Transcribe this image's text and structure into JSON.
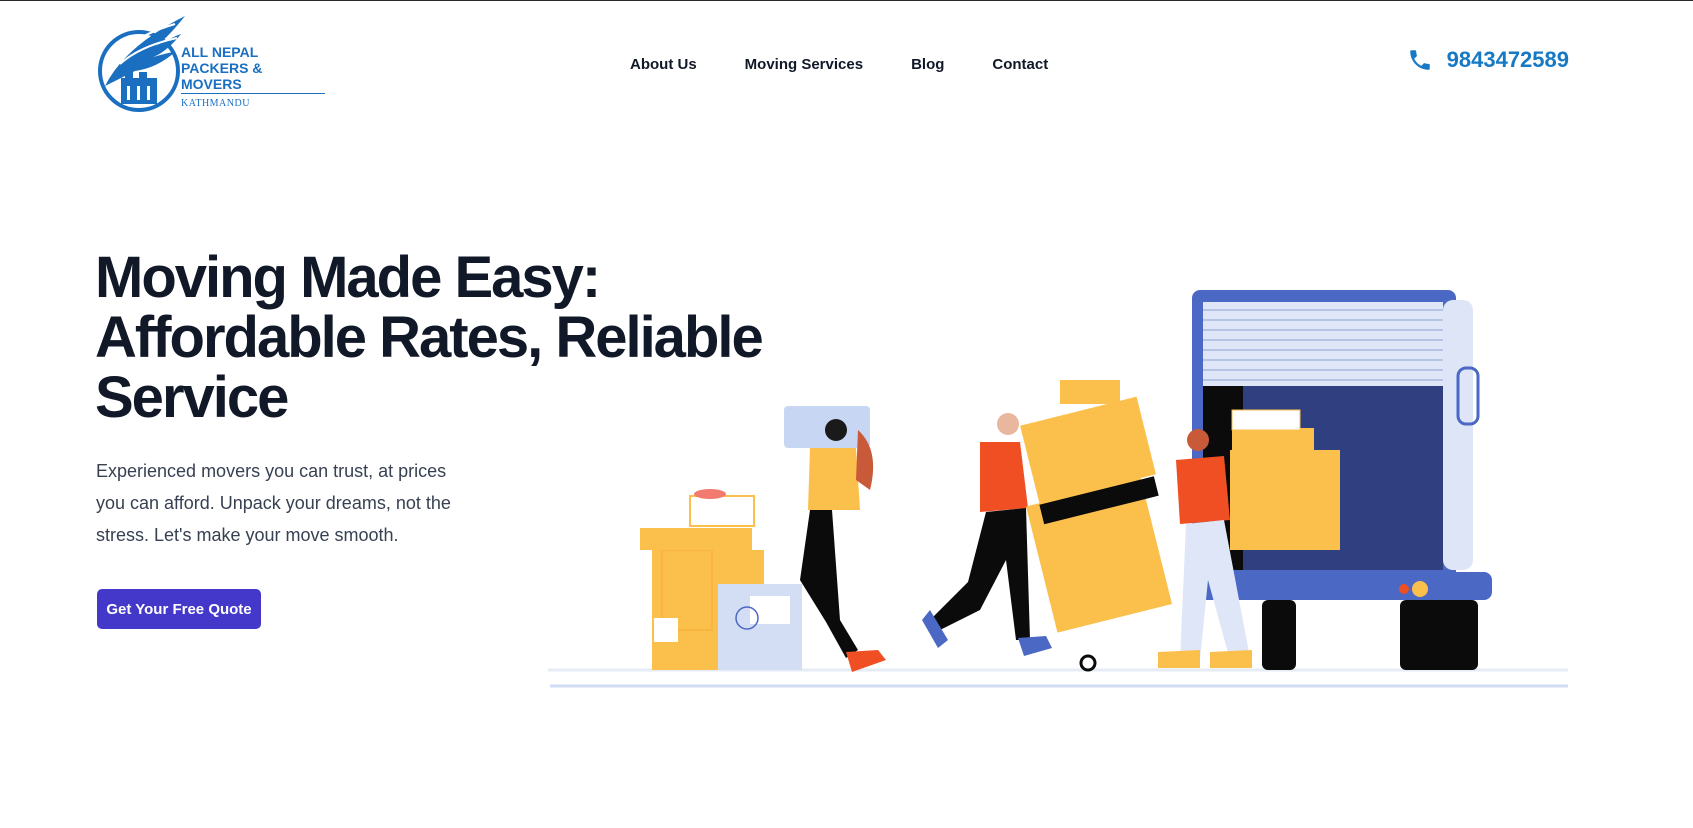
{
  "brand": {
    "line1": "ALL NEPAL",
    "line2": "PACKERS & MOVERS",
    "line3": "KATHMANDU",
    "color": "#1a6fc0"
  },
  "nav": {
    "items": [
      "About Us",
      "Moving Services",
      "Blog",
      "Contact"
    ]
  },
  "phone": {
    "icon": "phone-icon",
    "number": "9843472589",
    "color": "#1779c4"
  },
  "hero": {
    "title_lines": [
      "Moving Made Easy:",
      "Affordable Rates, Reliable",
      "Service"
    ],
    "subtitle": "Experienced movers you can trust, at prices you can afford. Unpack your dreams, not the stress. Let's make your move smooth.",
    "cta_label": "Get Your Free Quote",
    "cta_color": "#4338ca"
  },
  "illustration": {
    "name": "movers-loading-truck-illustration",
    "colors": {
      "truck": "#4a68c4",
      "box": "#fbbf4c",
      "shirt": "#f04e23"
    }
  }
}
